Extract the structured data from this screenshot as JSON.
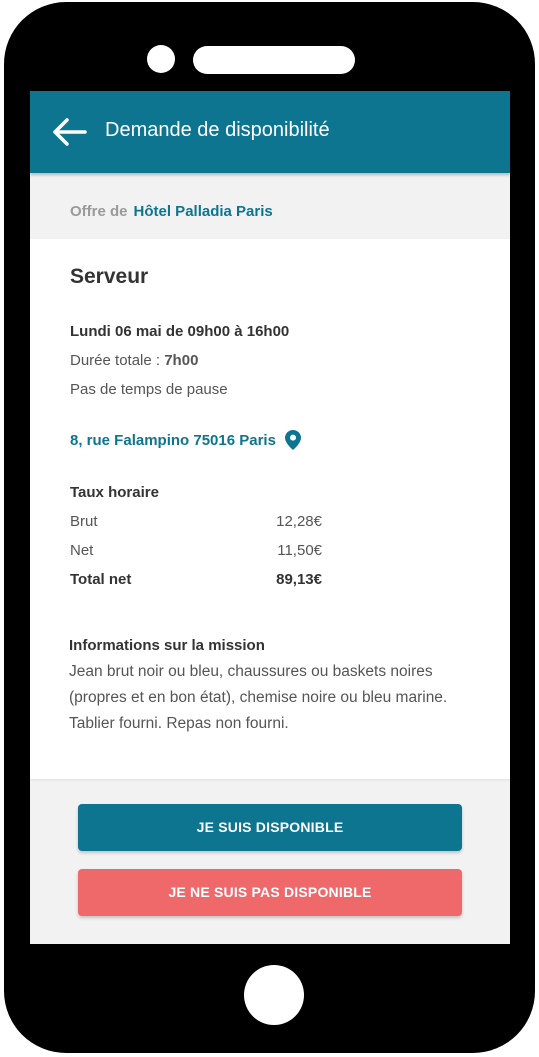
{
  "header": {
    "title": "Demande de disponibilité"
  },
  "offer": {
    "prefix": "Offre de",
    "hotel": "Hôtel Palladia Paris"
  },
  "job": {
    "title": "Serveur",
    "schedule": "Lundi 06 mai de 09h00 à 16h00",
    "duration_label": "Durée totale : ",
    "duration_value": "7h00",
    "pause": "Pas de temps de pause",
    "address": "8, rue Falampino 75016 Paris"
  },
  "rates": {
    "title": "Taux horaire",
    "rows": [
      {
        "label": "Brut",
        "value": "12,28€"
      },
      {
        "label": "Net",
        "value": "11,50€"
      },
      {
        "label": "Total net",
        "value": "89,13€"
      }
    ]
  },
  "mission": {
    "title": "Informations sur la mission",
    "text": "Jean brut noir ou bleu, chaussures ou baskets noires (propres et en bon état), chemise noire ou bleu marine. Tablier fourni. Repas non fourni."
  },
  "actions": {
    "available_label": "JE SUIS DISPONIBLE",
    "unavailable_label": "JE NE SUIS PAS DISPONIBLE"
  },
  "colors": {
    "primary": "#0e7590",
    "danger": "#f0696a"
  },
  "icons": {
    "back": "arrow-left-icon",
    "location": "map-pin-icon"
  }
}
